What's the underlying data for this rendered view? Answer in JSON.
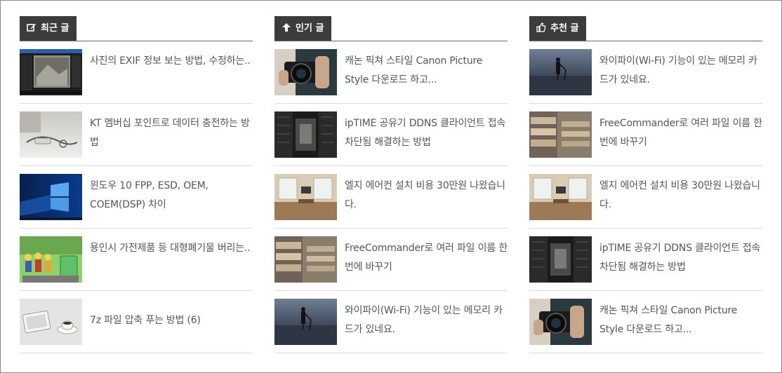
{
  "columns": [
    {
      "id": "recent",
      "label": "최근 글",
      "icon": "edit-icon",
      "posts": [
        {
          "title": "사진의 EXIF 정보 보는 방법, 수정하는..",
          "thumb": "exif-screenshot"
        },
        {
          "title": "KT 멤버십 포인트로 데이터 충전하는 방법",
          "thumb": "cable-device"
        },
        {
          "title": "윈도우 10 FPP, ESD, OEM, COEM(DSP) 차이",
          "thumb": "windows10-wallpaper"
        },
        {
          "title": "용인시 가전제품 등 대형폐기물 버리는..",
          "thumb": "recycling-figures"
        },
        {
          "title": "7z 파일 압축 푸는 방법 (6)",
          "thumb": "tablet-coffee"
        }
      ]
    },
    {
      "id": "popular",
      "label": "인기 글",
      "icon": "arrow-up-icon",
      "posts": [
        {
          "title": "캐논 픽쳐 스타일 Canon Picture Style 다운로드 하고...",
          "thumb": "camera-hands"
        },
        {
          "title": "ipTIME 공유기 DDNS 클라이언트 접속 차단됨 해결하는 방법",
          "thumb": "server-room"
        },
        {
          "title": "엘지 에어컨 설치 비용 30만원 나왔습니다.",
          "thumb": "living-room"
        },
        {
          "title": "FreeCommander로 여러 파일 이름 한번에 바꾸기",
          "thumb": "file-shelves"
        },
        {
          "title": "와이파이(Wi-Fi) 기능이 있는 메모리 카드가 있네요.",
          "thumb": "photographer-beach"
        }
      ]
    },
    {
      "id": "featured",
      "label": "추천 글",
      "icon": "thumbs-up-icon",
      "posts": [
        {
          "title": "와이파이(Wi-Fi) 기능이 있는 메모리 카드가 있네요.",
          "thumb": "photographer-beach"
        },
        {
          "title": "FreeCommander로 여러 파일 이름 한번에 바꾸기",
          "thumb": "file-shelves"
        },
        {
          "title": "엘지 에어컨 설치 비용 30만원 나왔습니다.",
          "thumb": "living-room"
        },
        {
          "title": "ipTIME 공유기 DDNS 클라이언트 접속 차단됨 해결하는 방법",
          "thumb": "server-room"
        },
        {
          "title": "캐논 픽쳐 스타일 Canon Picture Style 다운로드 하고...",
          "thumb": "camera-hands"
        }
      ]
    }
  ],
  "colors": {
    "tab_bg": "#3c3c3c",
    "tab_text": "#ffffff",
    "divider": "#dcdcdc",
    "title_text": "#555555"
  }
}
